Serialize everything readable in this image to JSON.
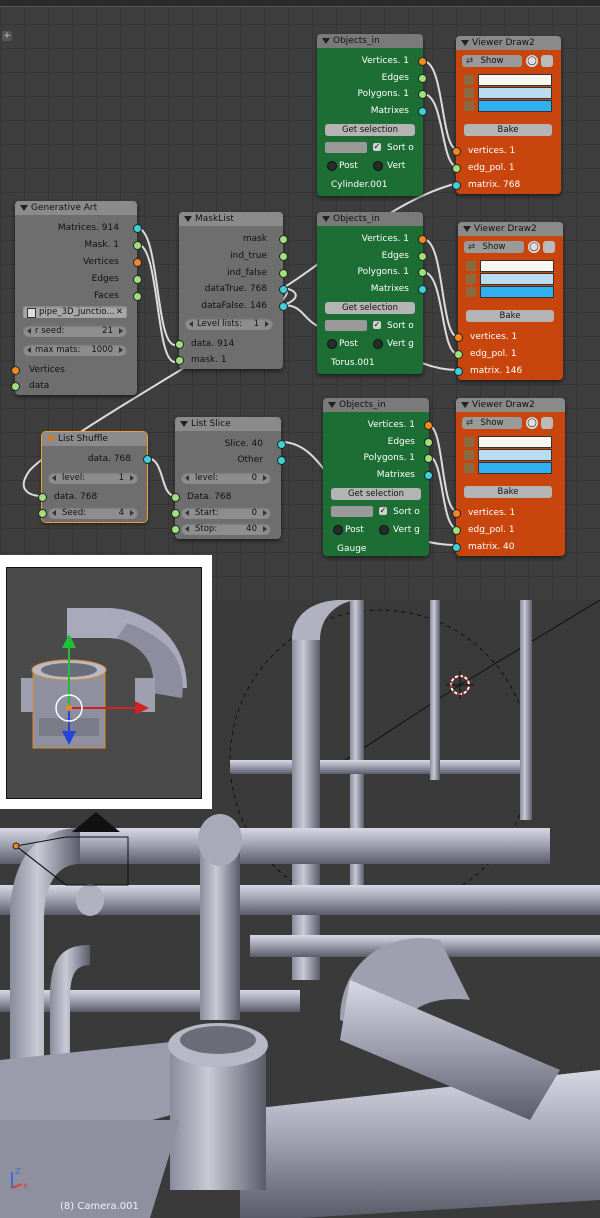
{
  "node_editor": {
    "generative_art": {
      "title": "Generative Art",
      "out": [
        "Matrices. 914",
        "Mask. 1",
        "Vertices",
        "Edges",
        "Faces"
      ],
      "object": "pipe_3D_junctio...",
      "rseed_label": "r seed:",
      "rseed": "21",
      "maxmats_label": "max mats:",
      "maxmats": "1000",
      "in": [
        "Vertices",
        "data"
      ]
    },
    "mask_list": {
      "title": "MaskList",
      "out": [
        "mask",
        "ind_true",
        "ind_false",
        "dataTrue. 768",
        "dataFalse. 146"
      ],
      "level_label": "Level lists:",
      "level": "1",
      "in": [
        "data. 914",
        "mask. 1"
      ]
    },
    "list_shuffle": {
      "title": "List Shuffle",
      "out": [
        "data. 768"
      ],
      "level_label": "level:",
      "level": "1",
      "in_data": "data. 768",
      "seed_label": "Seed:",
      "seed": "4"
    },
    "list_slice": {
      "title": "List Slice",
      "out": [
        "Slice. 40",
        "Other"
      ],
      "level_label": "level:",
      "level": "0",
      "in_data": "Data. 768",
      "start_label": "Start:",
      "start": "0",
      "stop_label": "Stop:",
      "stop": "40"
    },
    "objects_in": [
      {
        "title": "Objects_in",
        "out": [
          "Vertices. 1",
          "Edges",
          "Polygons. 1",
          "Matrixes"
        ],
        "get_selection": "Get selection",
        "sort": "Sort o",
        "post": "Post",
        "vert": "Vert",
        "object": "Cylinder.001"
      },
      {
        "title": "Objects_in",
        "out": [
          "Vertices. 1",
          "Edges",
          "Polygons. 1",
          "Matrixes"
        ],
        "get_selection": "Get selection",
        "sort": "Sort o",
        "post": "Post",
        "vert": "Vert g",
        "object": "Torus.001"
      },
      {
        "title": "Objects_in",
        "out": [
          "Vertices. 1",
          "Edges",
          "Polygons. 1",
          "Matrixes"
        ],
        "get_selection": "Get selection",
        "sort": "Sort o",
        "post": "Post",
        "vert": "Vert g",
        "object": "Gauge"
      }
    ],
    "viewer_draw": [
      {
        "title": "Viewer Draw2",
        "show": "Show",
        "bake": "Bake",
        "in": [
          "vertices. 1",
          "edg_pol. 1",
          "matrix. 768"
        ]
      },
      {
        "title": "Viewer Draw2",
        "show": "Show",
        "bake": "Bake",
        "in": [
          "vertices. 1",
          "edg_pol. 1",
          "matrix. 146"
        ]
      },
      {
        "title": "Viewer Draw2",
        "show": "Show",
        "bake": "Bake",
        "in": [
          "vertices. 1",
          "edg_pol. 1",
          "matrix. 40"
        ]
      }
    ],
    "colors": {
      "vertex_socket": "#f08a20",
      "data_socket": "#9fe07a",
      "matrix_socket": "#3ed0d8",
      "objects_node": "#1c6e34",
      "viewer_node": "#c8460e",
      "viewer_bar_light": "#f8f8f0",
      "viewer_bar_blue": "#b8dcf0",
      "viewer_bar_cyan": "#30b0f0"
    },
    "plus_icon": "+"
  },
  "viewport": {
    "camera_label": "(8) Camera.001",
    "icons": [
      "axis-gizmo-icon",
      "camera-icon",
      "3d-cursor-icon",
      "move-widget-icon"
    ]
  }
}
